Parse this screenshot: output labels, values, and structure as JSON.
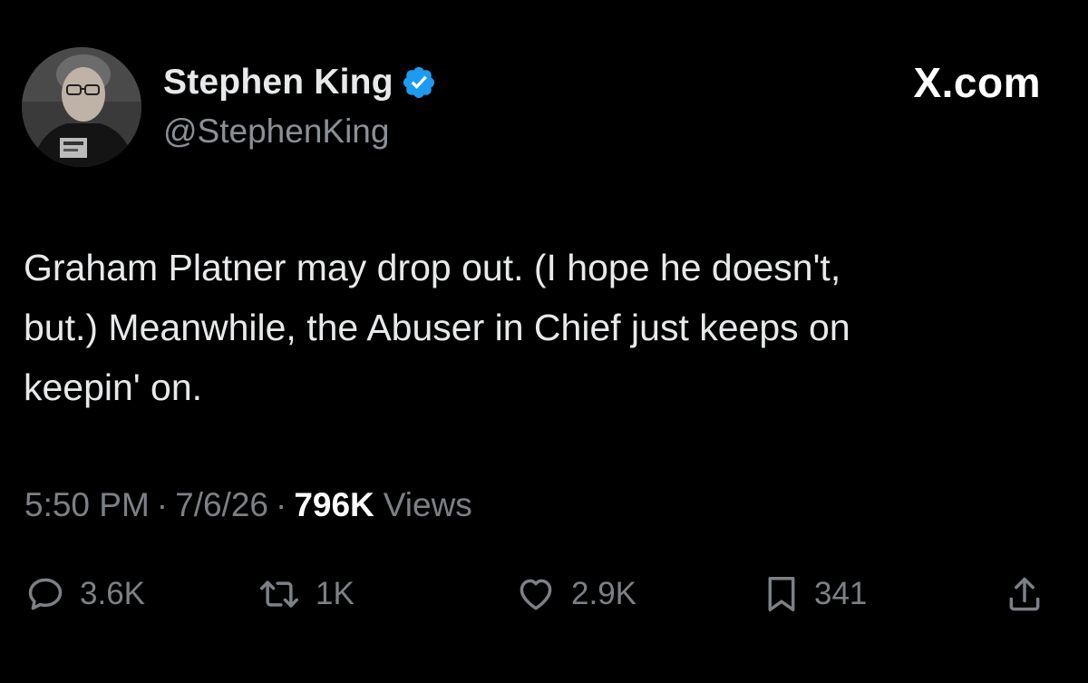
{
  "author": {
    "display_name": "Stephen King",
    "handle": "@StephenKing",
    "verified": true,
    "verified_color": "#1d9bf0"
  },
  "brand": "X.com",
  "tweet": {
    "text": "Graham Platner may drop out. (I hope he doesn't,\nbut.) Meanwhile, the Abuser in Chief just keeps on\nkeepin' on."
  },
  "meta": {
    "time": "5:50 PM",
    "date": "7/6/26",
    "views_count": "796K",
    "views_label": "Views",
    "separator": "·"
  },
  "actions": {
    "replies": "3.6K",
    "reposts": "1K",
    "likes": "2.9K",
    "bookmarks": "341"
  },
  "icons": {
    "reply": "reply-icon",
    "repost": "repost-icon",
    "like": "heart-icon",
    "bookmark": "bookmark-icon",
    "share": "share-icon",
    "verified": "verified-badge-icon"
  },
  "colors": {
    "background": "#000000",
    "text": "#e7e9ea",
    "muted": "#7d8186",
    "verified": "#1d9bf0"
  }
}
